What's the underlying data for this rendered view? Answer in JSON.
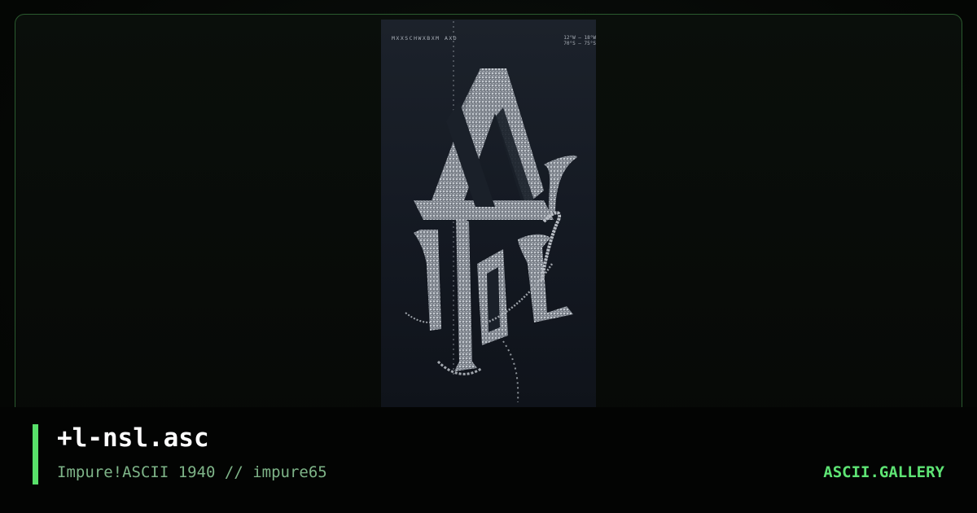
{
  "artwork": {
    "header_text": "MXXSCHWXBXM AXD",
    "coords_line1": "12°W — 18°W",
    "coords_line2": "70°S — 75°S"
  },
  "info": {
    "title": "+l-nsl.asc",
    "subtitle": "Impure!ASCII 1940 // impure65",
    "brand": "ASCII.GALLERY"
  },
  "colors": {
    "accent": "#58e06a",
    "brand": "#5ee474",
    "subtitle": "#7eb488",
    "frame_border": "#2a5a2e"
  }
}
